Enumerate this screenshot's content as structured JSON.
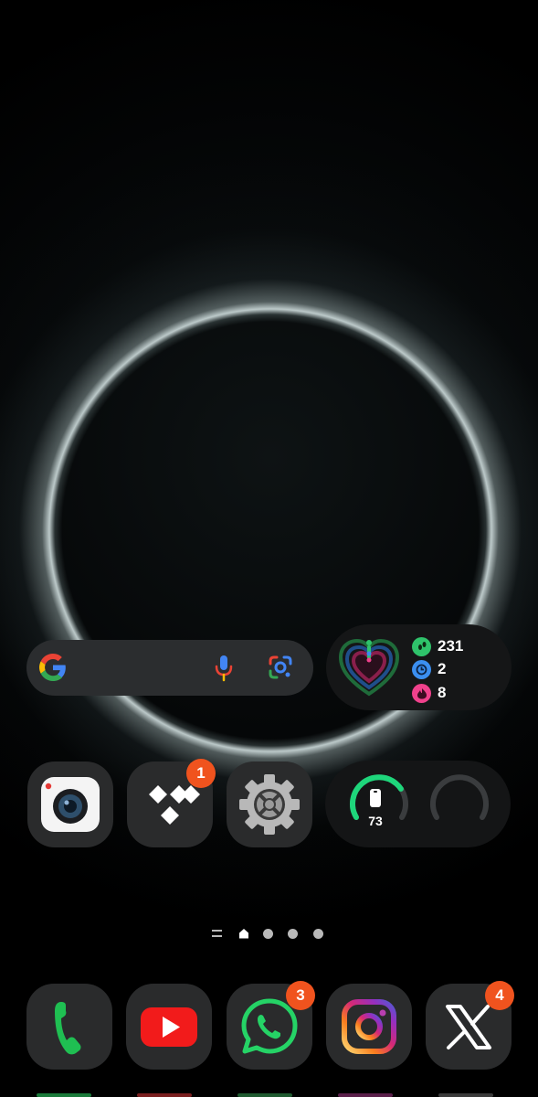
{
  "home_screen": {
    "search_widget": {
      "google_icon": "google-g-icon",
      "mic_icon": "microphone-icon",
      "lens_icon": "google-lens-icon"
    },
    "health_widget": {
      "steps": "231",
      "active_minutes": "2",
      "calories": "8",
      "colors": {
        "steps": "#2fc36b",
        "minutes": "#3b8ff0",
        "calories": "#f0418c"
      }
    },
    "apps": [
      {
        "name": "Camera",
        "icon": "camera-icon"
      },
      {
        "name": "TIDAL",
        "icon": "tidal-icon",
        "badge": "1"
      },
      {
        "name": "Settings",
        "icon": "settings-gear-icon"
      }
    ],
    "battery_widget": {
      "level": 73,
      "level_label": "73",
      "icon": "phone-icon"
    },
    "page_indicator": {
      "pages": 4,
      "current": 1
    }
  },
  "dock": [
    {
      "name": "Phone",
      "icon": "phone-handset-icon"
    },
    {
      "name": "YouTube",
      "icon": "youtube-icon"
    },
    {
      "name": "WhatsApp",
      "icon": "whatsapp-icon",
      "badge": "3"
    },
    {
      "name": "Instagram",
      "icon": "instagram-icon"
    },
    {
      "name": "X",
      "icon": "x-icon",
      "badge": "4"
    }
  ],
  "theme": {
    "badge_color": "#f0531e",
    "widget_bg": "#2b2d2f"
  }
}
